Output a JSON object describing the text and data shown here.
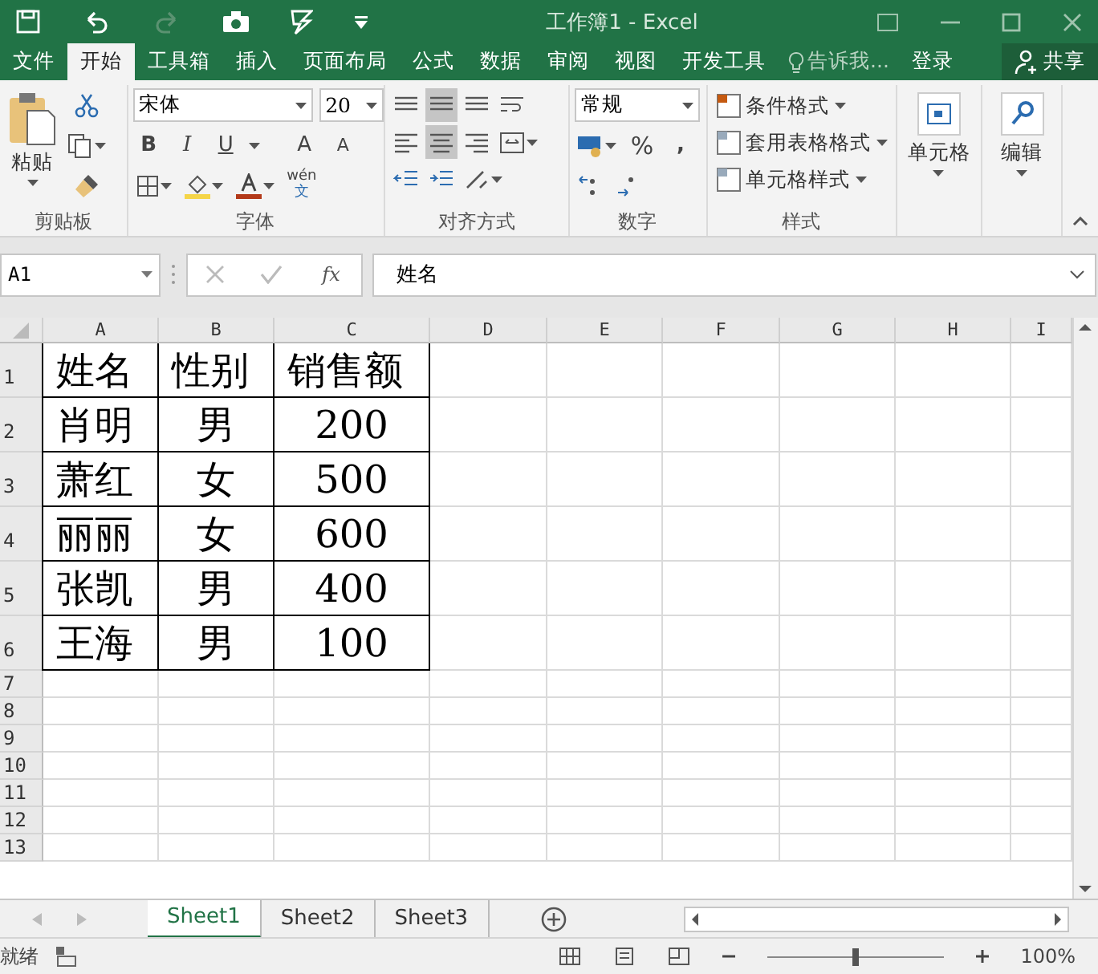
{
  "window": {
    "title": "工作簿1 - Excel"
  },
  "tabs": [
    {
      "label": "文件",
      "selected": false
    },
    {
      "label": "开始",
      "selected": true
    },
    {
      "label": "工具箱",
      "selected": false
    },
    {
      "label": "插入",
      "selected": false
    },
    {
      "label": "页面布局",
      "selected": false
    },
    {
      "label": "公式",
      "selected": false
    },
    {
      "label": "数据",
      "selected": false
    },
    {
      "label": "审阅",
      "selected": false
    },
    {
      "label": "视图",
      "selected": false
    },
    {
      "label": "开发工具",
      "selected": false
    }
  ],
  "tell_me": "告诉我...",
  "sign_in": "登录",
  "share": "共享",
  "ribbon": {
    "clipboard": {
      "paste": "粘贴",
      "label": "剪贴板"
    },
    "font": {
      "name": "宋体",
      "size": "20",
      "bold": "B",
      "italic": "I",
      "underline": "U",
      "grow": "A",
      "shrink": "A",
      "phonetic_top": "wén",
      "phonetic_bottom": "文",
      "label": "字体"
    },
    "alignment": {
      "label": "对齐方式"
    },
    "number": {
      "format": "常规",
      "percent": "%",
      "comma": ",",
      "label": "数字"
    },
    "styles": {
      "items": [
        "条件格式",
        "套用表格格式",
        "单元格样式"
      ],
      "label": "样式"
    },
    "cells": {
      "label": "单元格"
    },
    "editing": {
      "label": "编辑"
    }
  },
  "formula_bar": {
    "name_box": "A1",
    "function_label": "fx",
    "value": "姓名"
  },
  "sheet": {
    "columns": [
      "A",
      "B",
      "C",
      "D",
      "E",
      "F",
      "G",
      "H",
      "I"
    ],
    "rows": [
      {
        "header": "1",
        "cells": [
          "姓名",
          "性别",
          "销售额"
        ]
      },
      {
        "header": "2",
        "cells": [
          "肖明",
          "男",
          "200"
        ]
      },
      {
        "header": "3",
        "cells": [
          "萧红",
          "女",
          "500"
        ]
      },
      {
        "header": "4",
        "cells": [
          "丽丽",
          "女",
          "600"
        ]
      },
      {
        "header": "5",
        "cells": [
          "张凯",
          "男",
          "400"
        ]
      },
      {
        "header": "6",
        "cells": [
          "王海",
          "男",
          "100"
        ]
      },
      {
        "header": "7",
        "cells": []
      },
      {
        "header": "8",
        "cells": []
      },
      {
        "header": "9",
        "cells": []
      },
      {
        "header": "10",
        "cells": []
      },
      {
        "header": "11",
        "cells": []
      },
      {
        "header": "12",
        "cells": []
      },
      {
        "header": "13",
        "cells": []
      }
    ]
  },
  "sheet_tabs": [
    {
      "label": "Sheet1",
      "selected": true
    },
    {
      "label": "Sheet2",
      "selected": false
    },
    {
      "label": "Sheet3",
      "selected": false
    }
  ],
  "status_bar": {
    "state": "就绪",
    "zoom_slider": {
      "level": 0.5
    },
    "zoom": "100%"
  }
}
